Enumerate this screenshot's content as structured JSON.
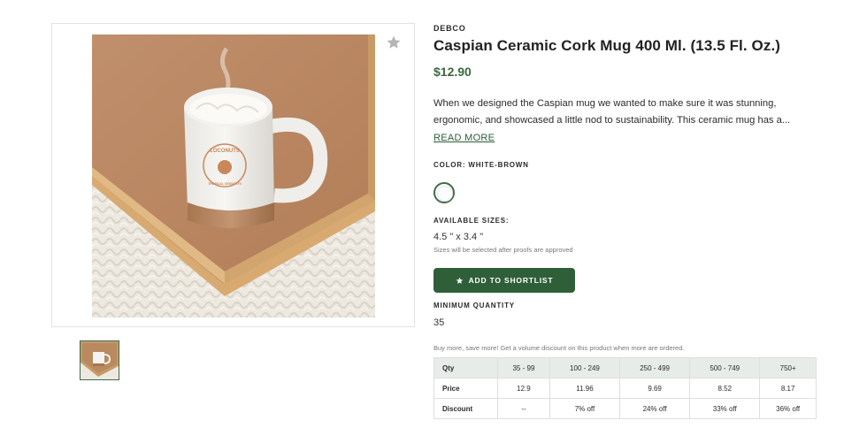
{
  "product": {
    "brand": "DEBCO",
    "title": "Caspian Ceramic Cork Mug 400 Ml. (13.5 Fl. Oz.)",
    "price": "$12.90",
    "description": "When we designed the Caspian mug we wanted to make sure it was stunning, ergonomic, and showcased a little nod to sustainability. This ceramic mug has a...",
    "read_more": "READ MORE",
    "logo_text_top": "LOCONUTS",
    "logo_text_bottom": "TROPICAL DESSERTS"
  },
  "color": {
    "label": "COLOR: WHITE-BROWN",
    "swatch_color": "#ffffff"
  },
  "sizes": {
    "label": "AVAILABLE SIZES:",
    "value": "4.5 \" x 3.4 \"",
    "note": "Sizes will be selected after proofs are approved"
  },
  "shortlist": {
    "label": "ADD TO SHORTLIST",
    "icon": "star-icon"
  },
  "minimum": {
    "label": "MINIMUM QUANTITY",
    "value": "35"
  },
  "volume_note": "Buy more, save more! Get a volume discount on this product when more are ordered.",
  "pricing_table": {
    "headers": [
      "Qty",
      "35 - 99",
      "100 - 249",
      "250 - 499",
      "500 - 749",
      "750+"
    ],
    "rows": [
      [
        "Price",
        "12.9",
        "11.96",
        "9.69",
        "8.52",
        "8.17"
      ],
      [
        "Discount",
        "--",
        "7% off",
        "24% off",
        "33% off",
        "36% off"
      ]
    ]
  },
  "colors": {
    "accent": "#2f5f38",
    "price": "#3a6a3e",
    "table_header_bg": "#e7ece9"
  }
}
